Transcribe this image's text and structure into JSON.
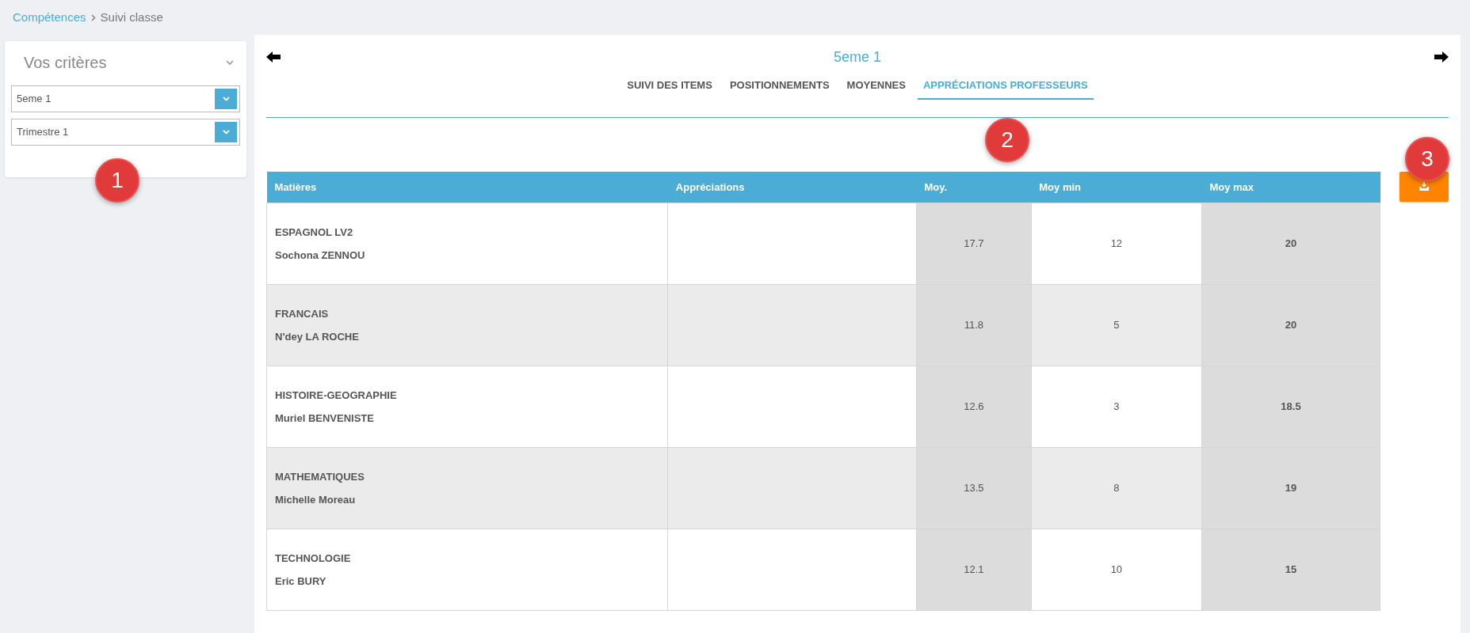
{
  "breadcrumb": [
    "Compétences",
    "Suivi classe"
  ],
  "criteria": {
    "title": "Vos critères",
    "selects": [
      {
        "value": "5eme 1"
      },
      {
        "value": "Trimestre 1"
      }
    ]
  },
  "main": {
    "title": "5eme 1",
    "tabs": [
      {
        "label": "SUIVI DES ITEMS",
        "selected": false
      },
      {
        "label": "POSITIONNEMENTS",
        "selected": false
      },
      {
        "label": "MOYENNES",
        "selected": false
      },
      {
        "label": "APPRÉCIATIONS PROFESSEURS",
        "selected": true
      }
    ],
    "table": {
      "columns": [
        "Matières",
        "Appréciations",
        "Moy.",
        "Moy min",
        "Moy max"
      ],
      "rows": [
        {
          "subject": "ESPAGNOL LV2",
          "teacher": "Sochona ZENNOU",
          "moy": "17.7",
          "min": "12",
          "max": "20"
        },
        {
          "subject": "FRANCAIS",
          "teacher": "N'dey LA ROCHE",
          "moy": "11.8",
          "min": "5",
          "max": "20"
        },
        {
          "subject": "HISTOIRE-GEOGRAPHIE",
          "teacher": "Muriel BENVENISTE",
          "moy": "12.6",
          "min": "3",
          "max": "18.5"
        },
        {
          "subject": "MATHEMATIQUES",
          "teacher": "Michelle Moreau",
          "moy": "13.5",
          "min": "8",
          "max": "19"
        },
        {
          "subject": "TECHNOLOGIE",
          "teacher": "Eric BURY",
          "moy": "12.1",
          "min": "10",
          "max": "15"
        }
      ]
    }
  },
  "callouts": [
    {
      "label": "1"
    },
    {
      "label": "2"
    },
    {
      "label": "3"
    }
  ]
}
